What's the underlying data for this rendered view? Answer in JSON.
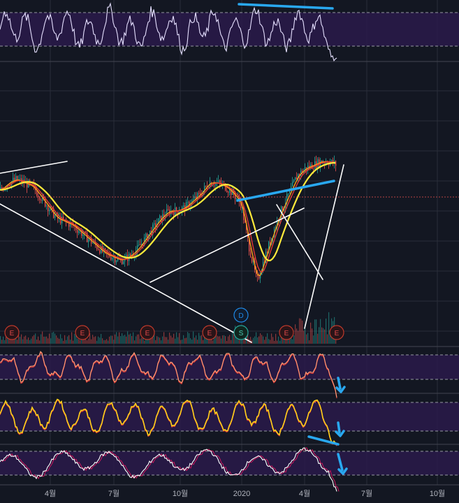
{
  "chart_data": {
    "type": "candlestick",
    "x_ticks": [
      "4월",
      "7월",
      "10월",
      "2020",
      "4월",
      "7월",
      "10월"
    ],
    "earnings_markers": [
      "E",
      "E",
      "E",
      "E",
      "E",
      "E"
    ],
    "dividend_marker": "D",
    "split_marker": "S",
    "price_series": {
      "ticks": [
        0,
        5,
        10,
        15,
        20,
        25,
        30,
        35,
        40,
        45,
        50,
        55,
        60,
        65,
        70,
        75,
        80,
        85,
        90,
        95,
        100,
        105,
        110,
        115,
        120,
        125,
        130,
        135,
        140,
        145,
        150,
        155,
        160,
        165,
        170,
        175,
        180,
        185,
        190,
        195,
        200,
        205,
        210
      ],
      "values": [
        64,
        66,
        67,
        66,
        65,
        62,
        59,
        56,
        55,
        54,
        52,
        50,
        48,
        46,
        45,
        44,
        45,
        47,
        50,
        53,
        56,
        58,
        58,
        59,
        61,
        63,
        66,
        66,
        65,
        63,
        60,
        48,
        38,
        45,
        52,
        58,
        63,
        68,
        70,
        71,
        72,
        72,
        71
      ]
    },
    "moving_averages": [
      {
        "color": "#ff9f1a"
      },
      {
        "color": "#e53935"
      },
      {
        "color": "#ffeb3b"
      }
    ],
    "indicator_panels": [
      {
        "color": "#e6e0ff",
        "upper_band": 70,
        "lower_band": 30
      },
      {
        "color": "#ffa37a",
        "upper_band": 70,
        "lower_band": 30
      },
      {
        "color": "#ffd21a",
        "upper_band": 80,
        "lower_band": 20
      },
      {
        "color": "#ffffff",
        "upper_band": 80,
        "lower_band": 20
      }
    ],
    "colors": {
      "background": "#131722",
      "band": "#2a1a4a",
      "trendline": "#ffffff",
      "divergence": "#29a8f0",
      "up_candle": "#26a69a",
      "down_candle": "#ef5350"
    }
  }
}
